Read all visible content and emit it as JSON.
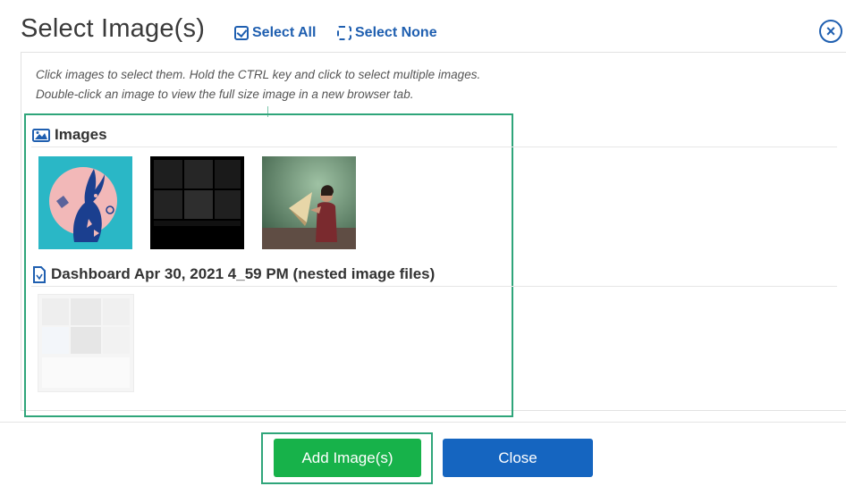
{
  "dialog": {
    "title": "Select Image(s)",
    "select_all": "Select All",
    "select_none": "Select None",
    "close_symbol": "×",
    "instructions": [
      "Click images to select them. Hold the CTRL key and click to select multiple images.",
      "Double-click an image to view the full size image in a new browser tab."
    ]
  },
  "sections": [
    {
      "label": "Images",
      "icon": "image-icon",
      "thumbnails": [
        "blue-rabbit-illustration",
        "dark-grid-image",
        "woman-with-hat-photo"
      ]
    },
    {
      "label": "Dashboard Apr 30, 2021 4_59 PM (nested image files)",
      "icon": "document-icon",
      "thumbnails": [
        "faint-grid-image"
      ]
    }
  ],
  "footer": {
    "add_label": "Add Image(s)",
    "close_label": "Close"
  },
  "colors": {
    "accent_blue": "#1f5fb0",
    "highlight_green": "#2fa57a",
    "add_button": "#17b24a",
    "close_button": "#1565c0"
  }
}
